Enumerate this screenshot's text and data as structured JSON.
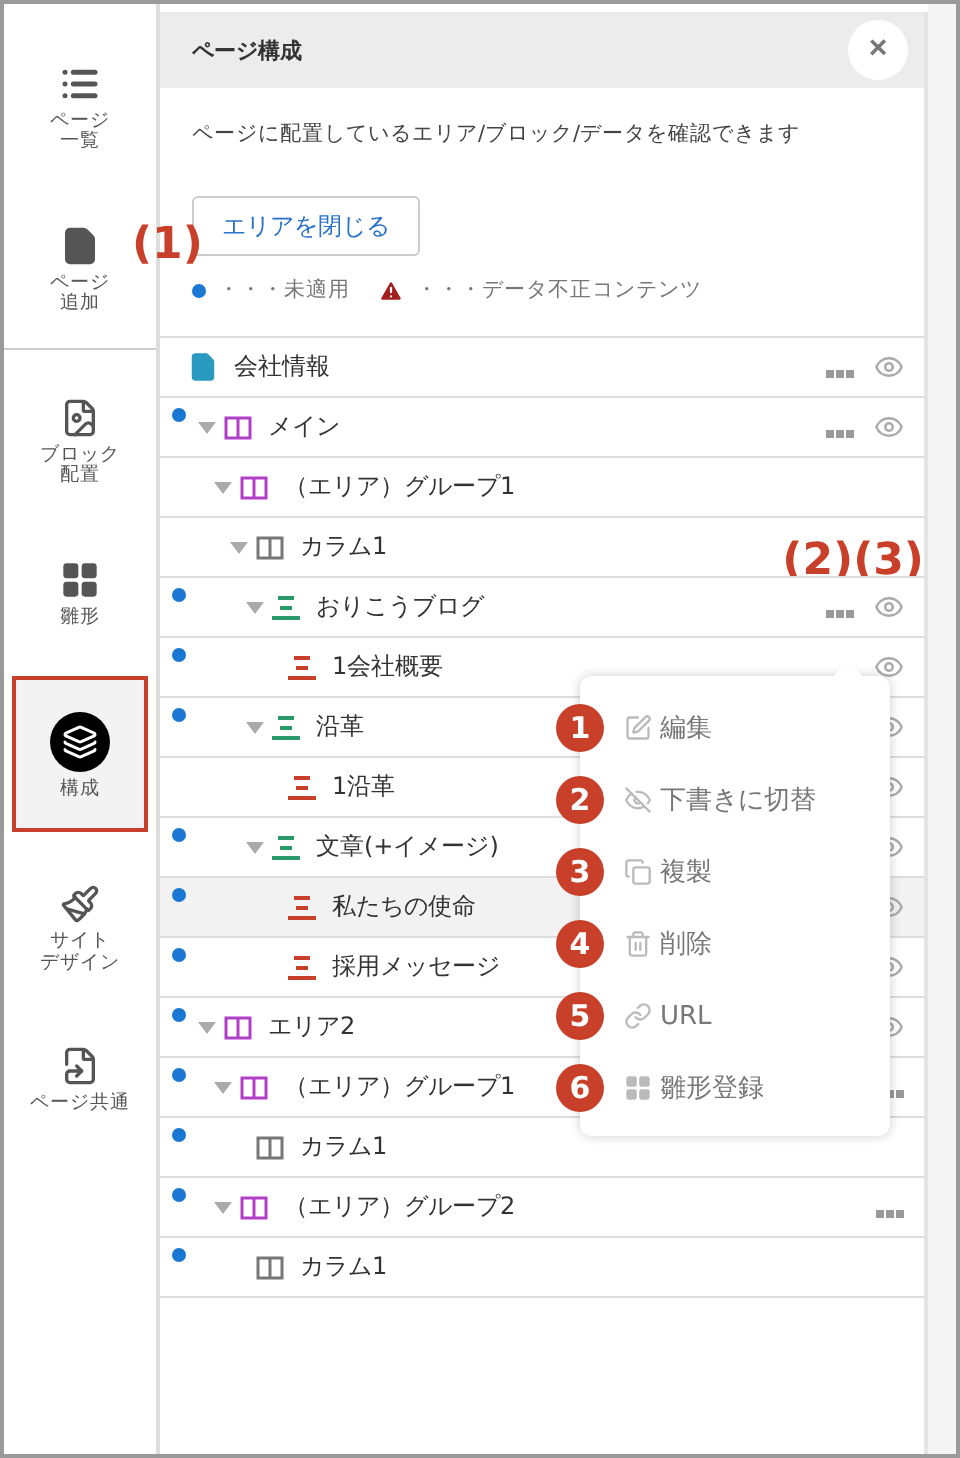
{
  "sidebar": {
    "items": [
      {
        "kind": "list",
        "label_lines": [
          "ページ",
          "一覧"
        ],
        "selected": false
      },
      {
        "kind": "add",
        "label_lines": [
          "ページ",
          "追加"
        ],
        "selected": false
      },
      {
        "kind": "block",
        "label_lines": [
          "ブロック",
          "配置"
        ],
        "selected": false
      },
      {
        "kind": "template",
        "label_lines": [
          "雛形"
        ],
        "selected": false
      },
      {
        "kind": "structure",
        "label_lines": [
          "構成"
        ],
        "selected": true
      },
      {
        "kind": "design",
        "label_lines": [
          "サイト",
          "デザイン"
        ],
        "selected": false
      },
      {
        "kind": "common",
        "label_lines": [
          "ページ共通"
        ],
        "selected": false
      }
    ]
  },
  "panel": {
    "title": "ページ構成",
    "close": "×",
    "description": "ページに配置しているエリア/ブロック/データを確認できます",
    "collapse_button": "エリアを閉じる",
    "legend": [
      {
        "kind": "dot",
        "text": "・・・未適用"
      },
      {
        "kind": "warning",
        "text": "・・・データ不正コンテンツ"
      }
    ]
  },
  "tree": [
    {
      "kind": "page",
      "label": "会社情報",
      "unapplied": false,
      "more": true,
      "eye": true,
      "selected": false
    },
    {
      "kind": "area",
      "label": "メイン",
      "unapplied": true,
      "more": true,
      "eye": true,
      "selected": false,
      "expanded": true,
      "children": [
        {
          "kind": "area",
          "label": "（エリア）グループ1",
          "unapplied": false,
          "more": false,
          "eye": false,
          "selected": false,
          "expanded": true,
          "children": [
            {
              "kind": "column",
              "label": "カラム1",
              "unapplied": false,
              "more": false,
              "eye": false,
              "selected": false,
              "expanded": true,
              "callout": "(2)(3)",
              "children": [
                {
                  "kind": "block",
                  "label": "おりこうブログ",
                  "unapplied": true,
                  "more": true,
                  "eye": true,
                  "selected": false,
                  "expanded": true,
                  "children": [
                    {
                      "kind": "item",
                      "label": "1会社概要",
                      "unapplied": true,
                      "more": false,
                      "eye": true,
                      "selected": false
                    }
                  ]
                },
                {
                  "kind": "block",
                  "label": "沿革",
                  "unapplied": true,
                  "more": false,
                  "eye": true,
                  "selected": false,
                  "expanded": true,
                  "children": [
                    {
                      "kind": "item",
                      "label": "1沿革",
                      "unapplied": false,
                      "more": false,
                      "eye": true,
                      "selected": false
                    }
                  ]
                },
                {
                  "kind": "block",
                  "label": "文章(+イメージ)",
                  "unapplied": true,
                  "more": false,
                  "eye": true,
                  "selected": false,
                  "expanded": true,
                  "children": [
                    {
                      "kind": "item",
                      "label": "私たちの使命",
                      "unapplied": true,
                      "more": false,
                      "eye": true,
                      "selected": true
                    },
                    {
                      "kind": "item",
                      "label": "採用メッセージ",
                      "unapplied": true,
                      "more": false,
                      "eye": true,
                      "selected": false
                    }
                  ]
                }
              ]
            }
          ]
        }
      ]
    },
    {
      "kind": "area",
      "label": "エリア2",
      "unapplied": true,
      "more": false,
      "eye": true,
      "selected": false,
      "expanded": true,
      "children": [
        {
          "kind": "area",
          "label": "（エリア）グループ1",
          "unapplied": true,
          "more": true,
          "eye": false,
          "selected": false,
          "expanded": true,
          "children": [
            {
              "kind": "column",
              "label": "カラム1",
              "unapplied": true,
              "more": false,
              "eye": false,
              "selected": false
            }
          ]
        },
        {
          "kind": "area",
          "label": "（エリア）グループ2",
          "unapplied": true,
          "more": true,
          "eye": false,
          "selected": false,
          "expanded": true,
          "children": [
            {
              "kind": "column",
              "label": "カラム1",
              "unapplied": true,
              "more": false,
              "eye": false,
              "selected": false
            }
          ]
        }
      ]
    }
  ],
  "context_menu": {
    "items": [
      {
        "kind": "edit",
        "number": "1",
        "label": "編集"
      },
      {
        "kind": "draft",
        "number": "2",
        "label": "下書きに切替"
      },
      {
        "kind": "copy",
        "number": "3",
        "label": "複製"
      },
      {
        "kind": "delete",
        "number": "4",
        "label": "削除"
      },
      {
        "kind": "url",
        "number": "5",
        "label": "URL"
      },
      {
        "kind": "template",
        "number": "6",
        "label": "雛形登録"
      }
    ]
  },
  "annotations": [
    {
      "kind": "button",
      "text": "(1)"
    }
  ]
}
